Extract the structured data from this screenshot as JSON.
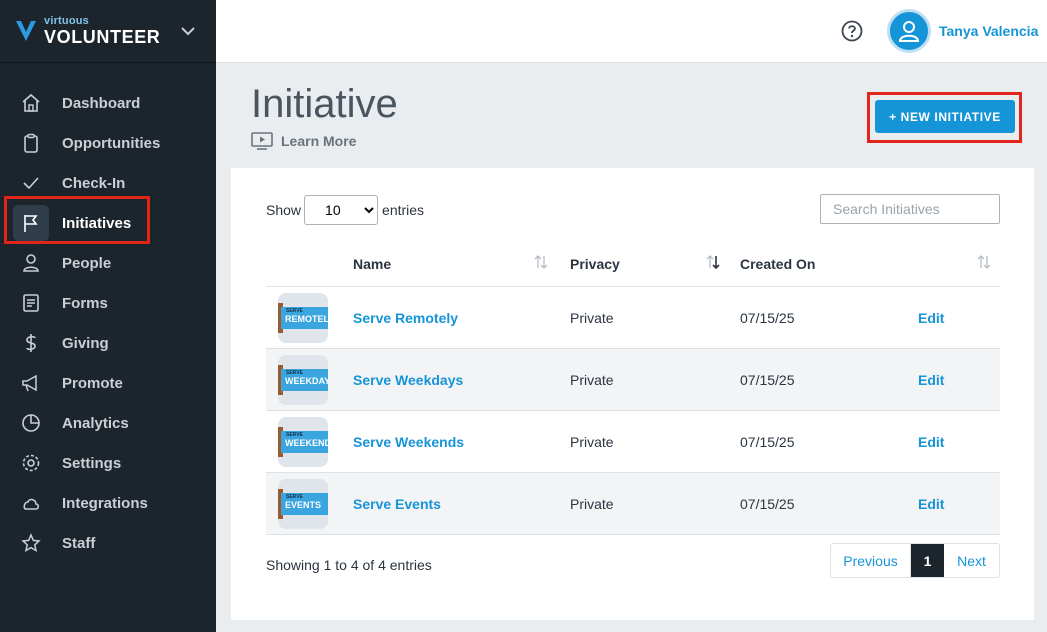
{
  "brand": {
    "small": "virtuous",
    "big": "VOLUNTEER"
  },
  "sidebar": {
    "items": [
      {
        "label": "Dashboard",
        "icon": "home-icon"
      },
      {
        "label": "Opportunities",
        "icon": "clipboard-icon"
      },
      {
        "label": "Check-In",
        "icon": "check-icon"
      },
      {
        "label": "Initiatives",
        "icon": "flag-icon",
        "active": true
      },
      {
        "label": "People",
        "icon": "person-icon"
      },
      {
        "label": "Forms",
        "icon": "form-icon"
      },
      {
        "label": "Giving",
        "icon": "dollar-icon"
      },
      {
        "label": "Promote",
        "icon": "megaphone-icon"
      },
      {
        "label": "Analytics",
        "icon": "pie-chart-icon"
      },
      {
        "label": "Settings",
        "icon": "gear-icon"
      },
      {
        "label": "Integrations",
        "icon": "cloud-icon"
      },
      {
        "label": "Staff",
        "icon": "star-icon"
      }
    ]
  },
  "header": {
    "user_name": "Tanya Valencia"
  },
  "page": {
    "title": "Initiative",
    "learn_more": "Learn More",
    "new_button": "+ NEW INITIATIVE"
  },
  "table": {
    "show_label": "Show",
    "entries_label": "entries",
    "page_size": "10",
    "search_placeholder": "Search Initiatives",
    "columns": [
      "Name",
      "Privacy",
      "Created On"
    ],
    "rows": [
      {
        "thumb_small": "SERVE",
        "thumb_word": "REMOTELY",
        "name": "Serve Remotely",
        "privacy": "Private",
        "created": "07/15/25",
        "action": "Edit"
      },
      {
        "thumb_small": "SERVE",
        "thumb_word": "WEEKDAYS",
        "name": "Serve Weekdays",
        "privacy": "Private",
        "created": "07/15/25",
        "action": "Edit"
      },
      {
        "thumb_small": "SERVE",
        "thumb_word": "WEEKENDS",
        "name": "Serve Weekends",
        "privacy": "Private",
        "created": "07/15/25",
        "action": "Edit"
      },
      {
        "thumb_small": "SERVE",
        "thumb_word": "EVENTS",
        "name": "Serve Events",
        "privacy": "Private",
        "created": "07/15/25",
        "action": "Edit"
      }
    ],
    "info": "Showing 1 to 4 of 4 entries",
    "pagination": {
      "previous": "Previous",
      "current": "1",
      "next": "Next"
    }
  },
  "colors": {
    "accent": "#1694d8",
    "sidebar": "#1d252c",
    "highlight": "#e1251b"
  }
}
